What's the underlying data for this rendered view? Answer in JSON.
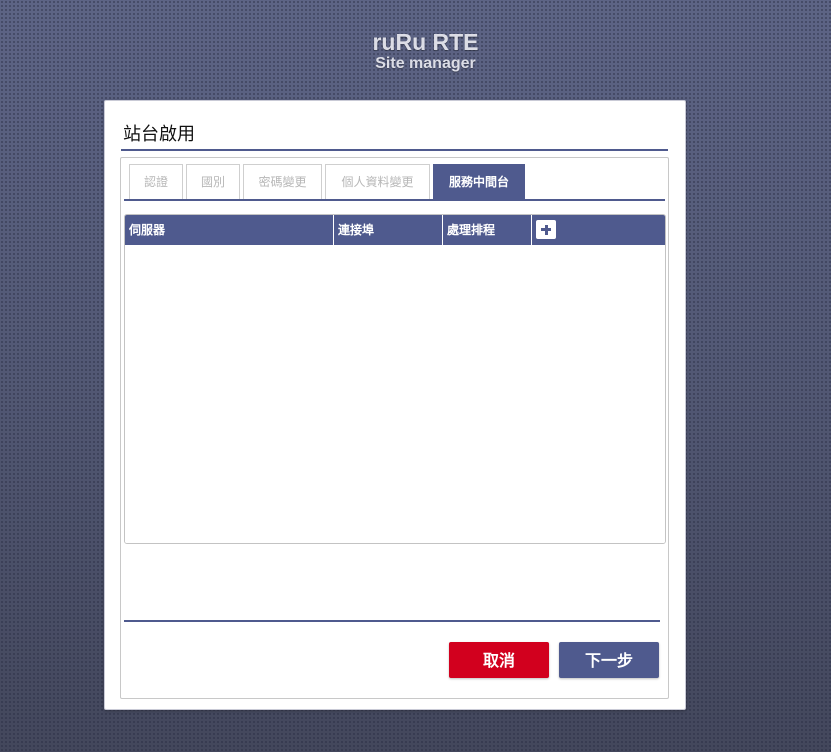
{
  "brand": {
    "title": "ruRu RTE",
    "subtitle": "Site manager"
  },
  "panel": {
    "heading": "站台啟用"
  },
  "tabs": [
    {
      "label": "認證",
      "active": false
    },
    {
      "label": "國別",
      "active": false
    },
    {
      "label": "密碼變更",
      "active": false
    },
    {
      "label": "個人資料變更",
      "active": false
    },
    {
      "label": "服務中間台",
      "active": true
    }
  ],
  "grid": {
    "columns": [
      "伺服器",
      "連接埠",
      "處理排程"
    ],
    "add_icon": "plus-icon",
    "rows": []
  },
  "buttons": {
    "cancel": "取消",
    "next": "下一步"
  },
  "colors": {
    "accent": "#4f5a8e",
    "danger": "#d2001e",
    "background": "#555b79"
  }
}
